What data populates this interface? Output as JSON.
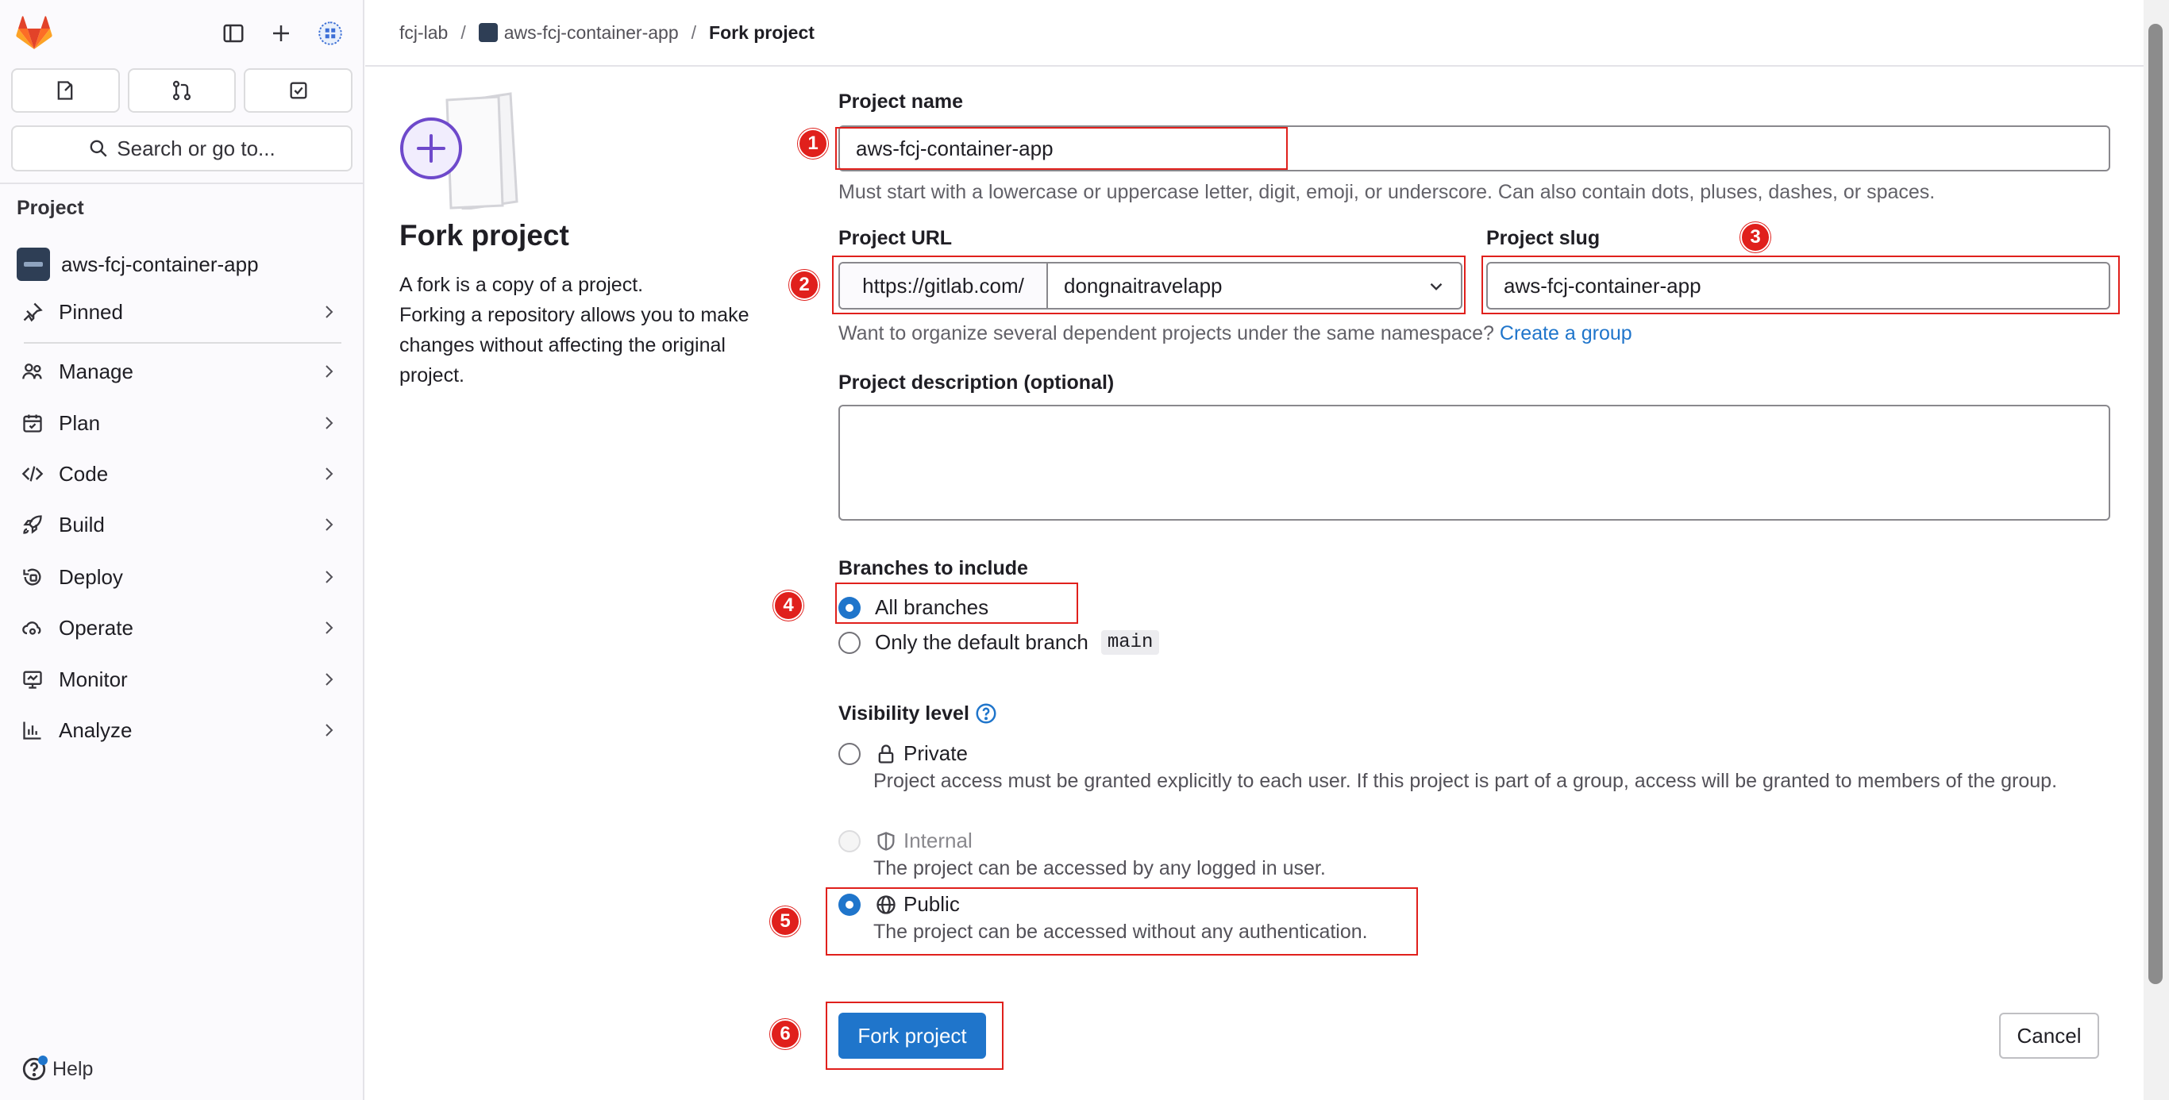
{
  "sidebar": {
    "search_label": "Search or go to...",
    "section_title": "Project",
    "project_name": "aws-fcj-container-app",
    "nav": [
      {
        "label": "Pinned",
        "icon": "pin-icon"
      },
      {
        "label": "Manage",
        "icon": "users-icon"
      },
      {
        "label": "Plan",
        "icon": "calendar-icon"
      },
      {
        "label": "Code",
        "icon": "code-icon"
      },
      {
        "label": "Build",
        "icon": "rocket-icon"
      },
      {
        "label": "Deploy",
        "icon": "deploy-icon"
      },
      {
        "label": "Operate",
        "icon": "cloud-gear-icon"
      },
      {
        "label": "Monitor",
        "icon": "monitor-icon"
      },
      {
        "label": "Analyze",
        "icon": "chart-icon"
      }
    ],
    "help_label": "Help"
  },
  "breadcrumb": {
    "group": "fcj-lab",
    "project": "aws-fcj-container-app",
    "current": "Fork project"
  },
  "intro": {
    "title": "Fork project",
    "line1": "A fork is a copy of a project.",
    "line2": "Forking a repository allows you to make changes without affecting the original project."
  },
  "form": {
    "project_name_label": "Project name",
    "project_name_value": "aws-fcj-container-app",
    "project_name_help": "Must start with a lowercase or uppercase letter, digit, emoji, or underscore. Can also contain dots, pluses, dashes, or spaces.",
    "project_url_label": "Project URL",
    "url_prefix": "https://gitlab.com/",
    "namespace_value": "dongnaitravelapp",
    "project_slug_label": "Project slug",
    "project_slug_value": "aws-fcj-container-app",
    "namespace_help": "Want to organize several dependent projects under the same namespace?",
    "create_group_link": "Create a group",
    "description_label": "Project description (optional)",
    "branches_label": "Branches to include",
    "branch_all": "All branches",
    "branch_default": "Only the default branch",
    "branch_default_name": "main",
    "visibility_label": "Visibility level",
    "private_label": "Private",
    "private_desc": "Project access must be granted explicitly to each user. If this project is part of a group, access will be granted to members of the group.",
    "internal_label": "Internal",
    "internal_desc": "The project can be accessed by any logged in user.",
    "public_label": "Public",
    "public_desc": "The project can be accessed without any authentication.",
    "submit_label": "Fork project",
    "cancel_label": "Cancel"
  },
  "annotations": [
    "1",
    "2",
    "3",
    "4",
    "5",
    "6"
  ],
  "colors": {
    "accent": "#1f75cb",
    "annotation": "#e0201c",
    "illustration": "#6e49cb"
  }
}
